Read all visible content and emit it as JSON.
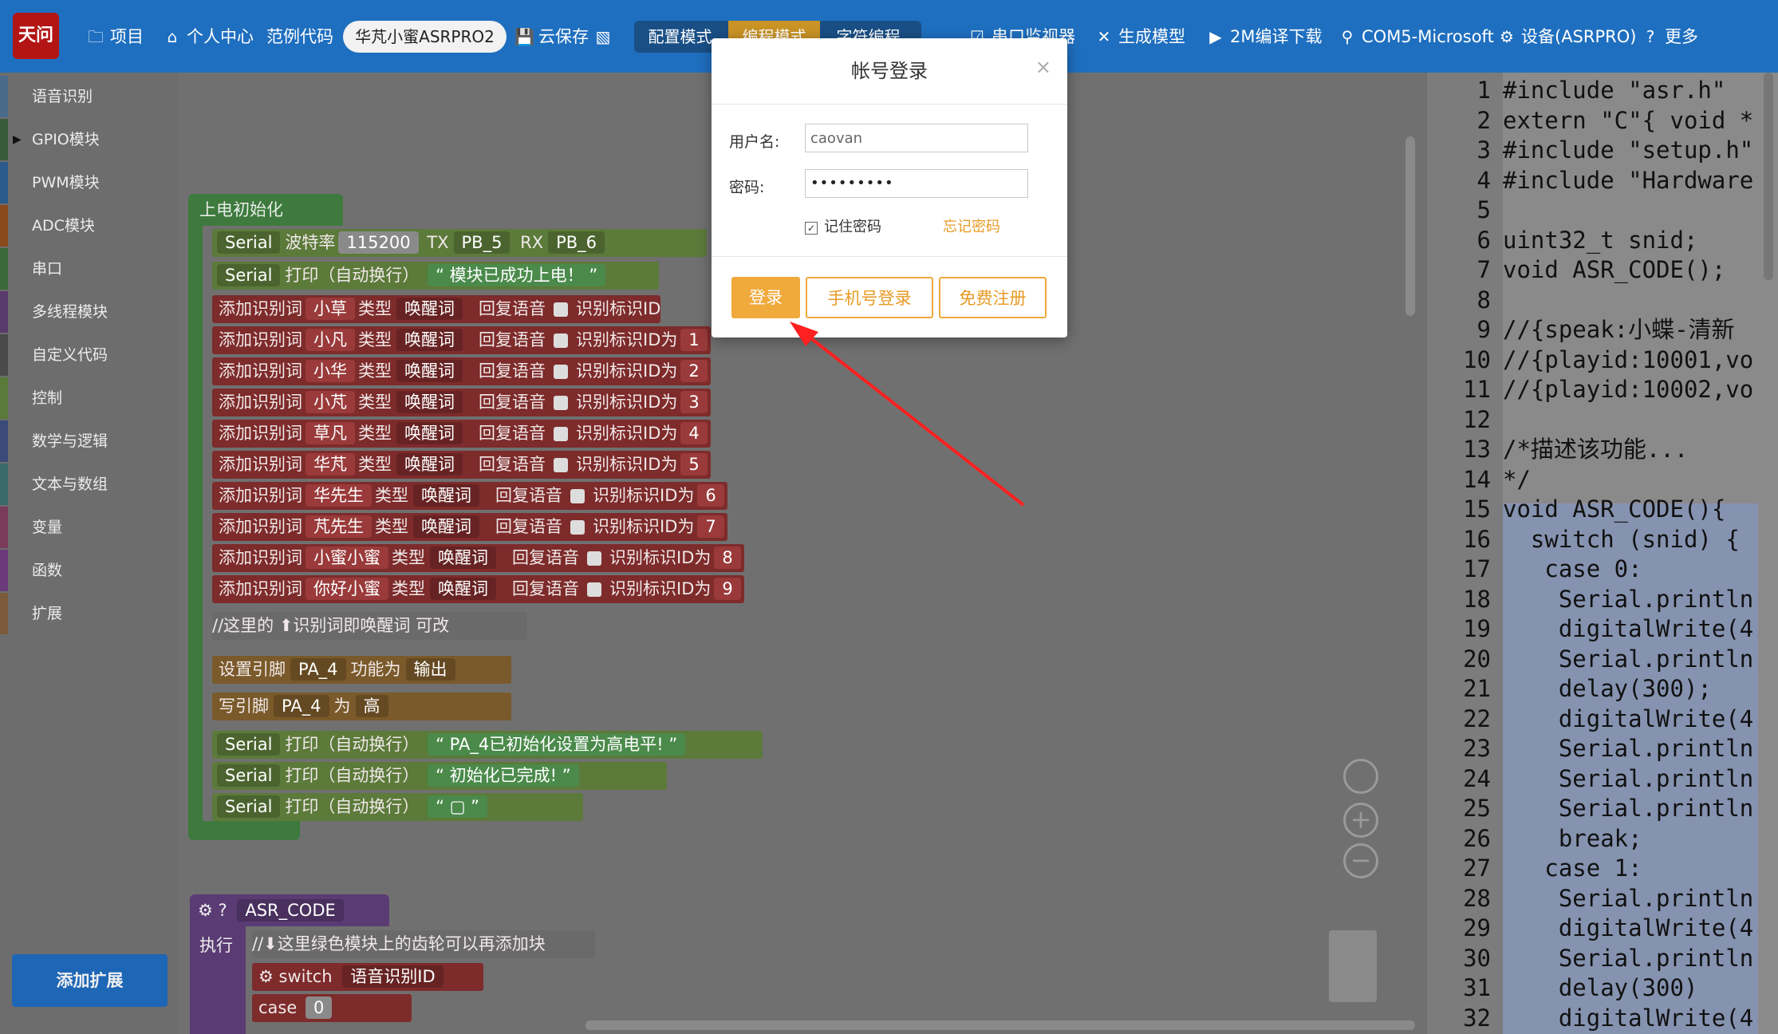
{
  "topbar": {
    "logo_text": "天问51",
    "project": "项目",
    "personal_center": "个人中心",
    "example_code": "范例代码",
    "device_name": "华芃小蜜ASRPRO2",
    "cloud_save": "云保存",
    "config_mode": "配置模式",
    "program_mode": "编程模式",
    "char_program": "字符编程",
    "serial_monitor": "串口监视器",
    "generate_model": "生成模型",
    "compile_download": "2M编译下载",
    "com_port": "COM5-Microsoft",
    "device": "设备(ASRPRO)",
    "more": "更多"
  },
  "sidebar": {
    "items": [
      {
        "label": "语音识别",
        "color": "#4a6a8a"
      },
      {
        "label": "GPIO模块",
        "color": "#3a5b3a",
        "active": true
      },
      {
        "label": "PWM模块",
        "color": "#2a5b8a"
      },
      {
        "label": "ADC模块",
        "color": "#8a4a1a"
      },
      {
        "label": "串口",
        "color": "#3a6a3a"
      },
      {
        "label": "多线程模块",
        "color": "#5a3a6a"
      },
      {
        "label": "自定义代码",
        "color": "#4a4a4a"
      },
      {
        "label": "控制",
        "color": "#5a7a3a"
      },
      {
        "label": "数学与逻辑",
        "color": "#3a4a7a"
      },
      {
        "label": "文本与数组",
        "color": "#3a6a6a"
      },
      {
        "label": "变量",
        "color": "#7a3a5a"
      },
      {
        "label": "函数",
        "color": "#6a3a7a"
      },
      {
        "label": "扩展",
        "color": "#7a5a3a"
      }
    ],
    "add_extension": "添加扩展"
  },
  "workspace": {
    "init_block": "上电初始化",
    "serial_baud": {
      "serial": "Serial",
      "baud_label": "波特率",
      "baud": "115200",
      "tx_label": "TX",
      "tx": "PB_5",
      "rx_label": "RX",
      "rx": "PB_6"
    },
    "serial_print1": {
      "serial": "Serial",
      "label": "打印（自动换行）",
      "text": "模块已成功上电！"
    },
    "words": [
      {
        "word": "小草",
        "id": ""
      },
      {
        "word": "小凡",
        "id": "1"
      },
      {
        "word": "小华",
        "id": "2"
      },
      {
        "word": "小芃",
        "id": "3"
      },
      {
        "word": "草凡",
        "id": "4"
      },
      {
        "word": "华芃",
        "id": "5"
      },
      {
        "word": "华先生",
        "id": "6"
      },
      {
        "word": "芃先生",
        "id": "7"
      },
      {
        "word": "小蜜小蜜",
        "id": "8"
      },
      {
        "word": "你好小蜜",
        "id": "9"
      }
    ],
    "word_labels": {
      "add": "添加识别词",
      "type": "类型",
      "type_val": "唤醒词",
      "reply": "回复语音",
      "id_label": "识别标识ID为",
      "id_label_short": "识别标识ID"
    },
    "comment1": "//这里的 ⬆识别词即唤醒词 可改",
    "set_pin": {
      "label": "设置引脚",
      "pin": "PA_4",
      "func": "功能为",
      "mode": "输出"
    },
    "write_pin": {
      "label": "写引脚",
      "pin": "PA_4",
      "to": "为",
      "level": "高"
    },
    "print2": "PA_4已初始化设置为高电平!",
    "print3": "初始化已完成!",
    "print_label": "打印（自动换行）",
    "serial": "Serial",
    "asr_block": "ASR_CODE",
    "exec_label": "执行",
    "comment2": "//⬇这里绿色模块上的齿轮可以再添加块",
    "switch_label": "switch",
    "switch_val": "语音识别ID",
    "case_label": "case",
    "case_val": "0"
  },
  "code": {
    "lines": [
      {
        "n": "1",
        "t": "#include \"asr.h\""
      },
      {
        "n": "2",
        "t": "extern \"C\"{ void *"
      },
      {
        "n": "3",
        "t": "#include \"setup.h\""
      },
      {
        "n": "4",
        "t": "#include \"Hardware"
      },
      {
        "n": "5",
        "t": ""
      },
      {
        "n": "6",
        "t": "uint32_t snid;"
      },
      {
        "n": "7",
        "t": "void ASR_CODE();"
      },
      {
        "n": "8",
        "t": ""
      },
      {
        "n": "9",
        "t": "//{speak:小蝶-清新"
      },
      {
        "n": "10",
        "t": "//{playid:10001,vo"
      },
      {
        "n": "11",
        "t": "//{playid:10002,vo"
      },
      {
        "n": "12",
        "t": ""
      },
      {
        "n": "13",
        "t": "/*描述该功能..."
      },
      {
        "n": "14",
        "t": "*/"
      },
      {
        "n": "15",
        "t": "void ASR_CODE(){"
      },
      {
        "n": "16",
        "t": "  switch (snid) {"
      },
      {
        "n": "17",
        "t": "   case 0:"
      },
      {
        "n": "18",
        "t": "    Serial.println"
      },
      {
        "n": "19",
        "t": "    digitalWrite(4"
      },
      {
        "n": "20",
        "t": "    Serial.println"
      },
      {
        "n": "21",
        "t": "    delay(300);"
      },
      {
        "n": "22",
        "t": "    digitalWrite(4"
      },
      {
        "n": "23",
        "t": "    Serial.println"
      },
      {
        "n": "24",
        "t": "    Serial.println"
      },
      {
        "n": "25",
        "t": "    Serial.println"
      },
      {
        "n": "26",
        "t": "    break;"
      },
      {
        "n": "27",
        "t": "   case 1:"
      },
      {
        "n": "28",
        "t": "    Serial.println"
      },
      {
        "n": "29",
        "t": "    digitalWrite(4"
      },
      {
        "n": "30",
        "t": "    Serial.println"
      },
      {
        "n": "31",
        "t": "    delay(300)"
      },
      {
        "n": "32",
        "t": "    digitalWrite(4"
      }
    ]
  },
  "modal": {
    "title": "帐号登录",
    "close": "×",
    "username_label": "用户名:",
    "username_value": "caovan",
    "password_label": "密码:",
    "password_value": "•••••••••",
    "remember": "记住密码",
    "forgot": "忘记密码",
    "login": "登录",
    "phone_login": "手机号登录",
    "register": "免费注册"
  }
}
